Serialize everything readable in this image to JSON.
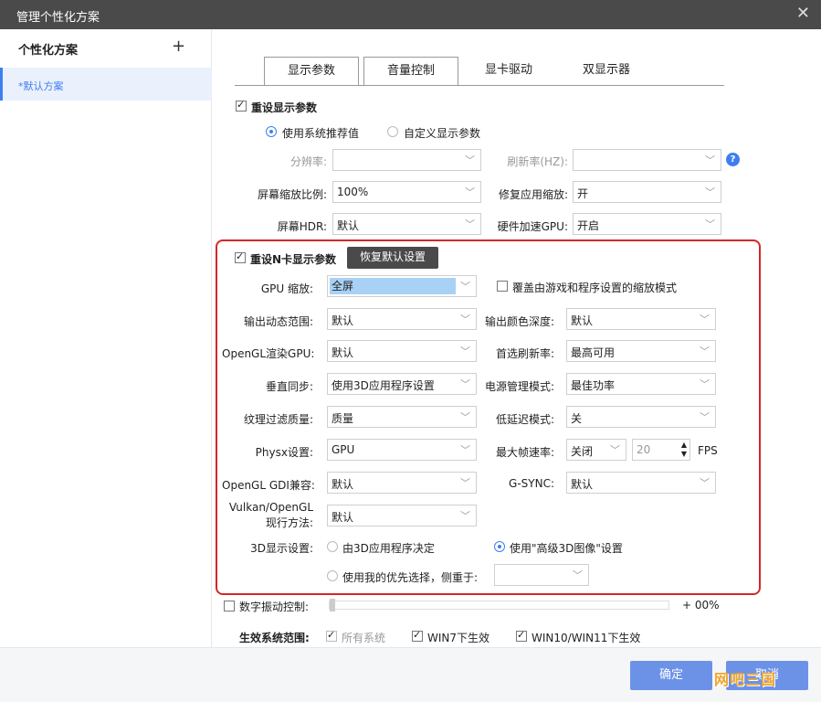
{
  "window": {
    "title": "管理个性化方案",
    "close_glyph": "✕"
  },
  "sidebar": {
    "title": "个性化方案",
    "add_glyph": "+",
    "items": [
      {
        "label": "*默认方案"
      }
    ]
  },
  "tabs": [
    {
      "label": "显示参数"
    },
    {
      "label": "音量控制"
    },
    {
      "label": "显卡驱动"
    },
    {
      "label": "双显示器"
    }
  ],
  "display": {
    "reset_label": "重设显示参数",
    "radio_system": "使用系统推荐值",
    "radio_custom": "自定义显示参数",
    "resolution_label": "分辨率:",
    "refresh_label": "刷新率(HZ):",
    "scale_label": "屏幕缩放比例:",
    "scale_value": "100%",
    "fix_scale_label": "修复应用缩放:",
    "fix_scale_value": "开",
    "hdr_label": "屏幕HDR:",
    "hdr_value": "默认",
    "hwgpu_label": "硬件加速GPU:",
    "hwgpu_value": "开启",
    "help_glyph": "?"
  },
  "nvidia": {
    "reset_label": "重设N卡显示参数",
    "restore_button": "恢复默认设置",
    "gpu_scale_label": "GPU 缩放:",
    "gpu_scale_value": "全屏",
    "override_label": "覆盖由游戏和程序设置的缩放模式",
    "dyn_range_label": "输出动态范围:",
    "dyn_range_value": "默认",
    "color_depth_label": "输出颜色深度:",
    "color_depth_value": "默认",
    "opengl_gpu_label": "OpenGL渲染GPU:",
    "opengl_gpu_value": "默认",
    "pref_refresh_label": "首选刷新率:",
    "pref_refresh_value": "最高可用",
    "vsync_label": "垂直同步:",
    "vsync_value": "使用3D应用程序设置",
    "power_label": "电源管理模式:",
    "power_value": "最佳功率",
    "texture_label": "纹理过滤质量:",
    "texture_value": "质量",
    "latency_label": "低延迟模式:",
    "latency_value": "关",
    "physx_label": "Physx设置:",
    "physx_value": "GPU",
    "maxfps_label": "最大帧速率:",
    "maxfps_value": "关闭",
    "maxfps_number": "20",
    "fps_unit": "FPS",
    "gdi_label": "OpenGL GDI兼容:",
    "gdi_value": "默认",
    "gsync_label": "G-SYNC:",
    "gsync_value": "默认",
    "vulkan_label_1": "Vulkan/OpenGL",
    "vulkan_label_2": "现行方法:",
    "vulkan_value": "默认",
    "d3_label": "3D显示设置:",
    "d3_radio_app": "由3D应用程序决定",
    "d3_radio_adv": "使用\"高级3D图像\"设置",
    "d3_radio_pref": "使用我的优先选择，侧重于:"
  },
  "vibrance": {
    "label": "数字振动控制:",
    "value": "+ 00%"
  },
  "scope": {
    "label": "生效系统范围:",
    "all": "所有系统",
    "win7": "WIN7下生效",
    "win10": "WIN10/WIN11下生效"
  },
  "footer": {
    "ok": "确定",
    "cancel": "取消",
    "watermark": "网吧三国"
  }
}
